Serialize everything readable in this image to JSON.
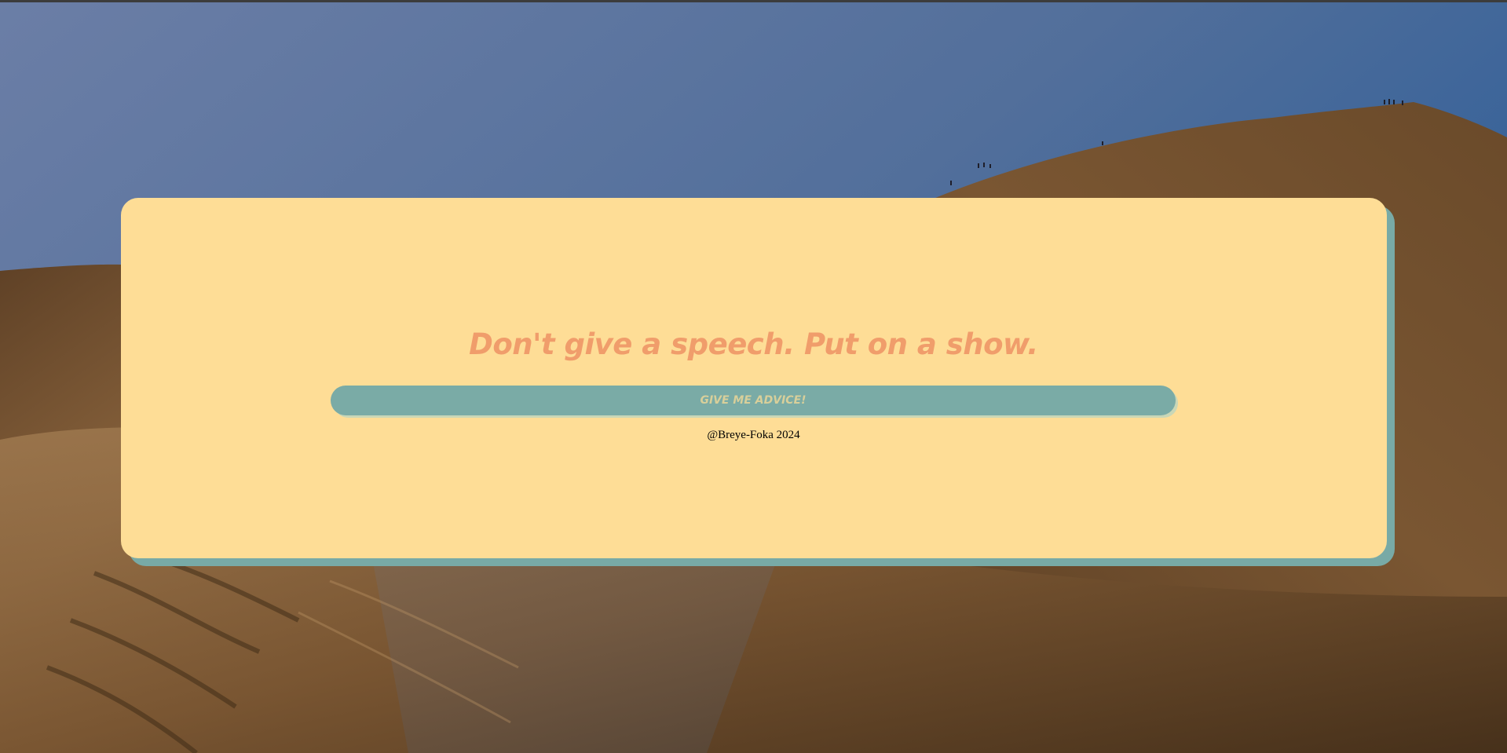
{
  "background": {
    "scene": "desert-dunes-photo",
    "sky_top": "#6b7ea6",
    "sky_right": "#2f5f97",
    "sand_dark": "#5b3f22",
    "sand_light": "#a57a4c"
  },
  "card": {
    "color": "#fedd96",
    "shadow_color": "#78aaa6",
    "quote": "Don't give a speech. Put on a show.",
    "quote_color": "#f09d6b",
    "button_label": "GIVE ME ADVICE!",
    "button_color": "#7aaba6",
    "credit": "@Breye-Foka 2024"
  }
}
